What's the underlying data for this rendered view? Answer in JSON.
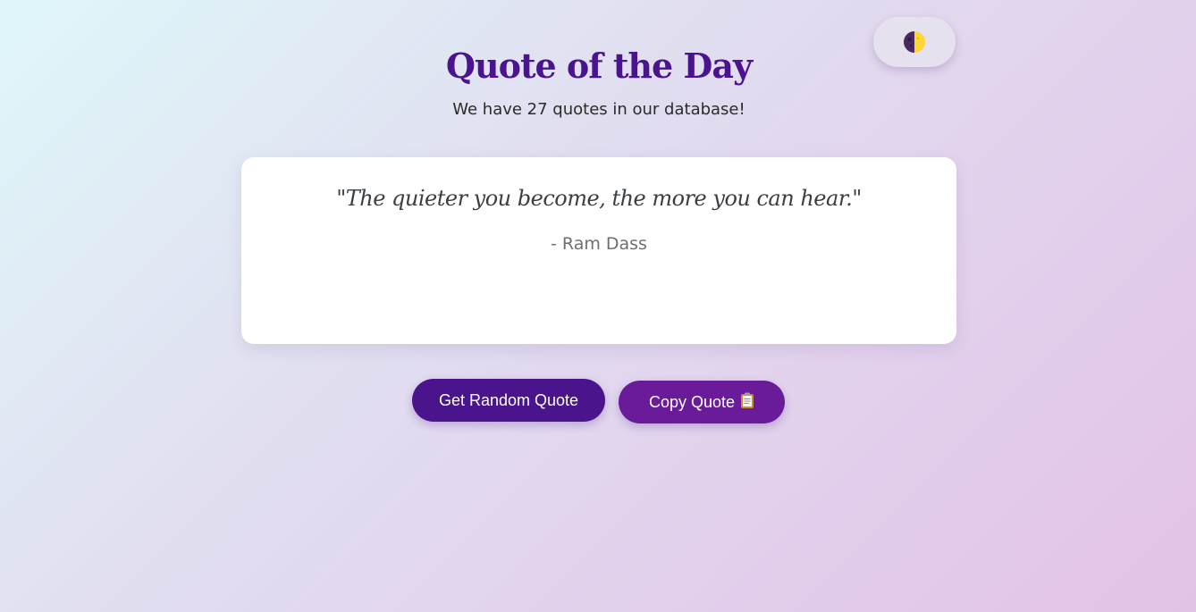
{
  "header": {
    "title": "Quote of the Day",
    "subtitle": "We have 27 quotes in our database!"
  },
  "theme_toggle": {
    "icon": "half-moon-theme-icon",
    "colors": {
      "dark": "#4a2a5e",
      "light": "#fdd835"
    }
  },
  "quote": {
    "text": "\"The quieter you become, the more you can hear.\"",
    "author": "- Ram Dass"
  },
  "actions": {
    "random_label": "Get Random Quote",
    "copy_label": "Copy Quote",
    "copy_icon": "clipboard-icon"
  },
  "colors": {
    "title": "#4a148c",
    "primary_button": "#4a148c",
    "secondary_button": "#6a1b9a"
  }
}
